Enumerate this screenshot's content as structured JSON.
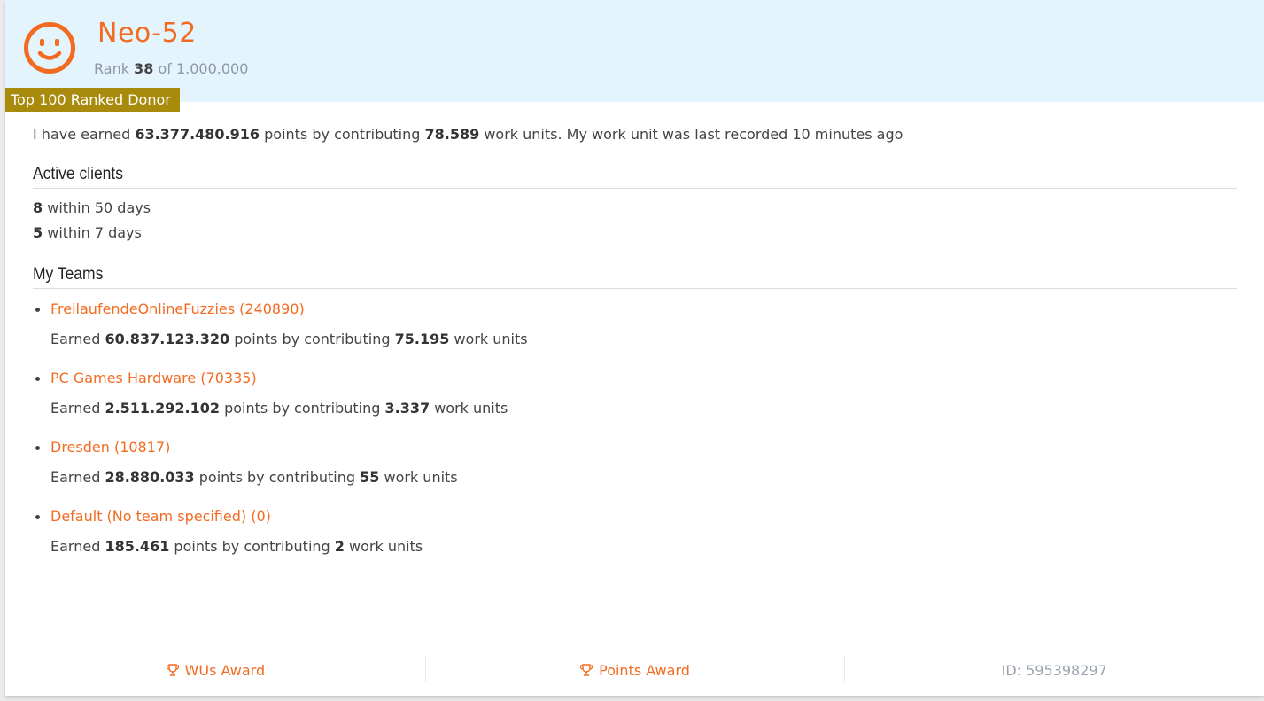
{
  "donor": {
    "name": "Neo-52",
    "rank_prefix": "Rank",
    "rank": "38",
    "rank_suffix": "of 1.000.000",
    "badge": "Top 100 Ranked Donor"
  },
  "summary": {
    "part1": "I have earned",
    "points": "63.377.480.916",
    "part2": "points by contributing",
    "work_units": "78.589",
    "part3": "work units. My work unit was last recorded 10 minutes ago"
  },
  "active_clients": {
    "title": "Active clients",
    "items": [
      {
        "count": "8",
        "label": "within 50 days"
      },
      {
        "count": "5",
        "label": "within 7 days"
      }
    ]
  },
  "teams": {
    "title": "My Teams",
    "earned_label": "Earned",
    "points_label": "points by contributing",
    "wu_label": "work units",
    "items": [
      {
        "name": "FreilaufendeOnlineFuzzies (240890)",
        "points": "60.837.123.320",
        "work_units": "75.195"
      },
      {
        "name": "PC Games Hardware (70335)",
        "points": "2.511.292.102",
        "work_units": "3.337"
      },
      {
        "name": "Dresden (10817)",
        "points": "28.880.033",
        "work_units": "55"
      },
      {
        "name": "Default (No team specified) (0)",
        "points": "185.461",
        "work_units": "2"
      }
    ]
  },
  "footer": {
    "wus_award": "WUs Award",
    "points_award": "Points Award",
    "id": "ID: 595398297"
  },
  "colors": {
    "accent": "#f26b21",
    "header_bg": "#e3f4fc",
    "badge_bg": "#a88a0c"
  },
  "icons": {
    "avatar": "smiley-face-icon",
    "award": "trophy-icon"
  }
}
